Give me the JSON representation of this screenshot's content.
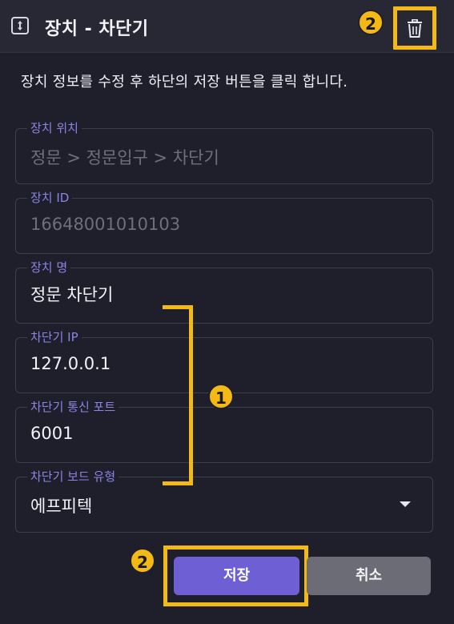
{
  "header": {
    "title": "장치 - 차단기",
    "icon": "expand-vertical-icon",
    "delete_icon": "trash-icon"
  },
  "instruction": "장치 정보를 수정 후 하단의 저장 버튼을 클릭 합니다.",
  "fields": [
    {
      "label": "장치 위치",
      "value": "정문 > 정문입구 > 차단기",
      "disabled": true
    },
    {
      "label": "장치 ID",
      "value": "16648001010103",
      "disabled": true
    },
    {
      "label": "장치 명",
      "value": "정문 차단기",
      "disabled": false
    },
    {
      "label": "차단기 IP",
      "value": "127.0.0.1",
      "disabled": false
    },
    {
      "label": "차단기 통신 포트",
      "value": "6001",
      "disabled": false
    },
    {
      "label": "차단기 보드 유형",
      "value": "에프피텍",
      "type": "select",
      "disabled": false
    }
  ],
  "buttons": {
    "save": "저장",
    "cancel": "취소"
  },
  "annotations": {
    "badge_1": "1",
    "badge_2_top": "2",
    "badge_2_bottom": "2",
    "color": "#f5b915"
  },
  "colors": {
    "accent": "#6e5fd4",
    "label": "#8b84e6",
    "background": "#1e1f2a",
    "header": "#272834"
  }
}
